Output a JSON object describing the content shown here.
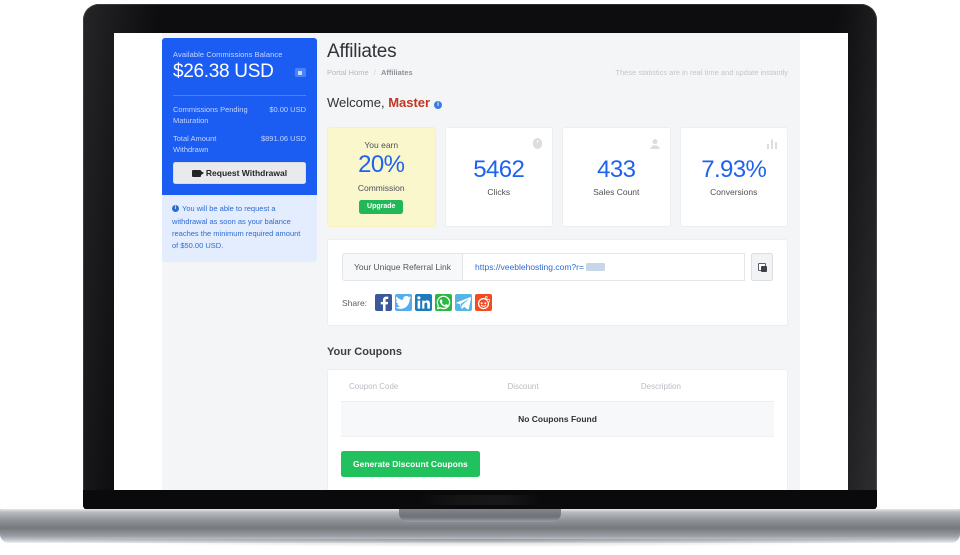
{
  "sidebar": {
    "balance": {
      "label": "Available Commissions Balance",
      "amount": "$26.38 USD",
      "toggle_icon": "eye-toggle-icon",
      "rows": [
        {
          "label": "Commissions Pending Maturation",
          "value": "$0.00 USD"
        },
        {
          "label": "Total Amount Withdrawn",
          "value": "$891.06 USD"
        }
      ],
      "withdraw_button": "Request Withdrawal"
    },
    "notice": "You will be able to request a withdrawal as soon as your balance reaches the minimum required amount of $50.00 USD."
  },
  "header": {
    "title": "Affiliates",
    "breadcrumb": {
      "home": "Portal Home",
      "separator": "/",
      "current": "Affiliates"
    },
    "note": "These statistics are in real time and update instantly"
  },
  "welcome": {
    "greeting": "Welcome,",
    "name": "Master",
    "info_icon": "info-icon"
  },
  "stats": [
    {
      "top": "You earn",
      "value": "20%",
      "caption": "Commission",
      "badge": "Upgrade",
      "icon": "",
      "highlight": true
    },
    {
      "top": "",
      "value": "5462",
      "caption": "Clicks",
      "badge": "",
      "icon": "mouse-icon",
      "highlight": false
    },
    {
      "top": "",
      "value": "433",
      "caption": "Sales Count",
      "badge": "",
      "icon": "user-icon",
      "highlight": false
    },
    {
      "top": "",
      "value": "7.93%",
      "caption": "Conversions",
      "badge": "",
      "icon": "bar-chart-icon",
      "highlight": false
    }
  ],
  "referral": {
    "label": "Your Unique Referral Link",
    "url": "https://veeblehosting.com?r=",
    "copy_icon": "copy-icon",
    "share_label": "Share:",
    "networks": [
      {
        "name": "facebook",
        "color": "#3b5998"
      },
      {
        "name": "twitter",
        "color": "#55acee"
      },
      {
        "name": "linkedin",
        "color": "#1d7bb9"
      },
      {
        "name": "whatsapp",
        "color": "#2cb742"
      },
      {
        "name": "telegram",
        "color": "#56b5e5"
      },
      {
        "name": "reddit",
        "color": "#f34a23"
      }
    ]
  },
  "coupons": {
    "title": "Your Coupons",
    "columns": [
      "Coupon Code",
      "Discount",
      "Description"
    ],
    "empty_text": "No Coupons Found",
    "generate_button": "Generate Discount Coupons"
  },
  "colors": {
    "brand_blue": "#1b5cf3",
    "value_blue": "#1f62f0",
    "accent_red": "#c2361f",
    "green": "#21c15e",
    "highlight_yellow": "#fbf7cc",
    "info_blue_bg": "#e3edfd"
  }
}
